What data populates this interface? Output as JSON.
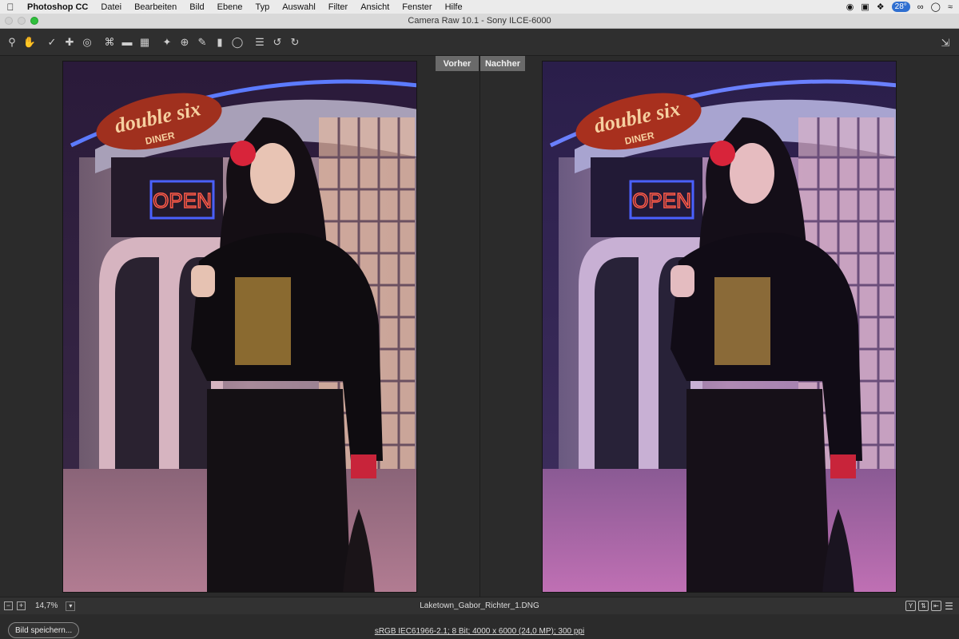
{
  "menubar": {
    "app_name": "Photoshop CC",
    "items": [
      "Datei",
      "Bearbeiten",
      "Bild",
      "Ebene",
      "Typ",
      "Auswahl",
      "Filter",
      "Ansicht",
      "Fenster",
      "Hilfe"
    ],
    "temperature": "28°"
  },
  "window": {
    "title": "Camera Raw 10.1 - Sony ILCE-6000"
  },
  "compare": {
    "before_label": "Vorher",
    "after_label": "Nachher"
  },
  "photo": {
    "sign_title": "double six",
    "sign_subtitle": "DINER",
    "neon_text": "OPEN"
  },
  "status": {
    "zoom": "14,7%",
    "filename": "Laketown_Gabor_Richter_1.DNG"
  },
  "footer": {
    "save_label": "Bild speichern...",
    "workflow": "sRGB IEC61966-2.1; 8 Bit; 4000 x 6000 (24,0 MP); 300 ppi"
  },
  "colors": {
    "accent_green": "#2fbf3c",
    "neon_blue": "#3d5cff",
    "neon_red": "#ff4a3a"
  }
}
